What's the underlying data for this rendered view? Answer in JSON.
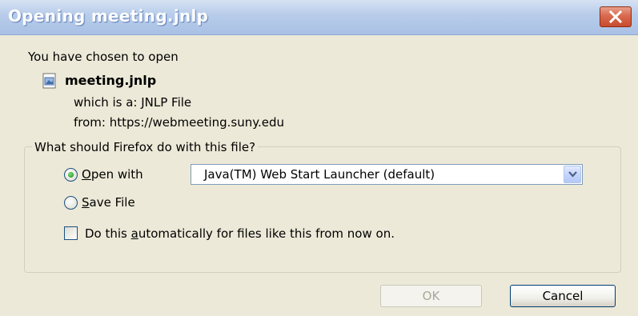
{
  "window": {
    "title": "Opening meeting.jnlp"
  },
  "dialog": {
    "intro": "You have chosen to open",
    "file_name": "meeting.jnlp",
    "which_is": "which is a:  JNLP File",
    "from": "from:  https://webmeeting.suny.edu"
  },
  "action_group": {
    "legend": "What should Firefox do with this file?",
    "open_with": {
      "accel": "O",
      "rest": "pen with",
      "selected": true
    },
    "open_with_app": {
      "value": "Java(TM) Web Start Launcher (default)"
    },
    "save_file": {
      "accel": "S",
      "rest": "ave File",
      "selected": false
    },
    "auto": {
      "pre": "Do this ",
      "accel": "a",
      "rest": "utomatically for files like this from now on.",
      "checked": false
    }
  },
  "buttons": {
    "ok": "OK",
    "cancel": "Cancel"
  },
  "icons": {
    "close": "close-icon",
    "file": "jnlp-file-icon",
    "dropdown": "chevron-down-icon"
  },
  "colors": {
    "titlebar": "#b9cdea",
    "close_button": "#d86a4e",
    "dialog_bg": "#ece9d8",
    "radio_selected": "#2ea02e"
  }
}
